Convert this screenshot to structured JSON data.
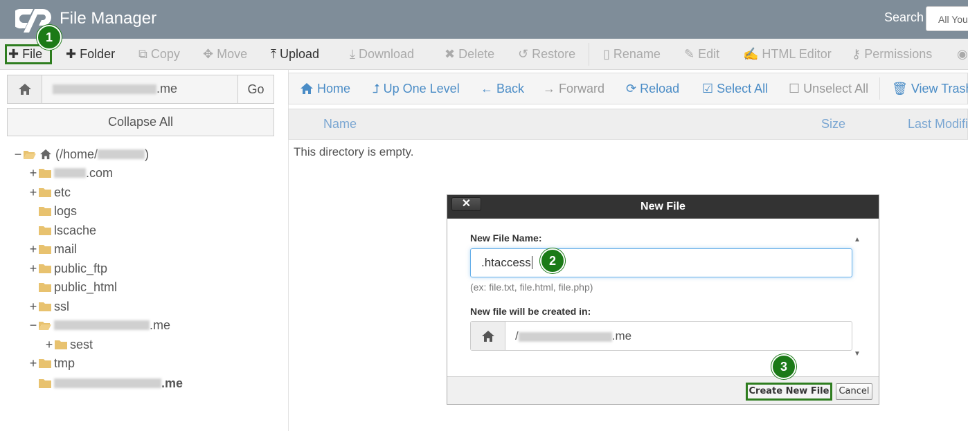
{
  "header": {
    "app_title": "File Manager",
    "search_label": "Search",
    "search_value": "All You"
  },
  "toolbar": {
    "file": "File",
    "folder": "Folder",
    "copy": "Copy",
    "move": "Move",
    "upload": "Upload",
    "download": "Download",
    "delete": "Delete",
    "restore": "Restore",
    "rename": "Rename",
    "edit": "Edit",
    "html_editor": "HTML Editor",
    "permissions": "Permissions"
  },
  "sidebar": {
    "path_suffix": ".me",
    "go_label": "Go",
    "collapse_all": "Collapse All",
    "tree": {
      "root_prefix": "(/home/",
      "root_suffix": ")",
      "item1_suffix": ".com",
      "etc": "etc",
      "logs": "logs",
      "lscache": "lscache",
      "mail": "mail",
      "public_ftp": "public_ftp",
      "public_html": "public_html",
      "ssl": "ssl",
      "domain_suffix": ".me",
      "sest": "sest",
      "tmp": "tmp",
      "last_suffix": ".me"
    }
  },
  "nav": {
    "home": "Home",
    "up_one_level": "Up One Level",
    "back": "Back",
    "forward": "Forward",
    "reload": "Reload",
    "select_all": "Select All",
    "unselect_all": "Unselect All",
    "view_trash": "View Trash"
  },
  "table": {
    "col_name": "Name",
    "col_size": "Size",
    "col_last_modified": "Last Modifie",
    "empty_message": "This directory is empty."
  },
  "dialog": {
    "title": "New File",
    "close_label": "✕",
    "name_label": "New File Name:",
    "name_value": ".htaccess",
    "hint": "(ex: file.txt, file.html, file.php)",
    "location_label": "New file will be created in:",
    "location_prefix": "/",
    "location_suffix": ".me",
    "create_button": "Create New File",
    "cancel_button": "Cancel"
  },
  "badges": {
    "step1": "1",
    "step2": "2",
    "step3": "3"
  },
  "colors": {
    "topbar": "#7f8d99",
    "accent_blue": "#4a8cc6",
    "highlight_green": "#2e7d1f",
    "folder": "#e8c26f"
  }
}
